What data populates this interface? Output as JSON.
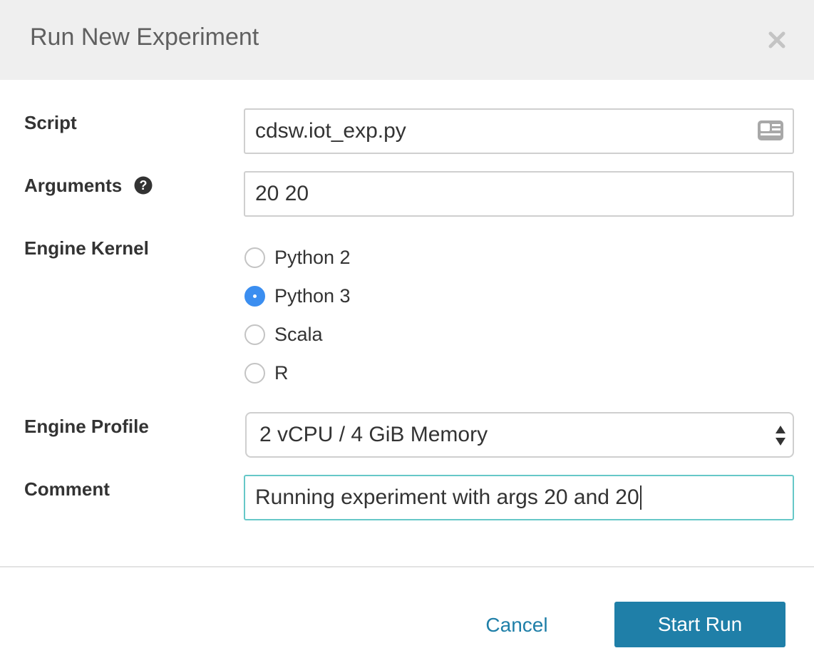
{
  "dialog": {
    "title": "Run New Experiment",
    "close_icon": "close-icon"
  },
  "form": {
    "script": {
      "label": "Script",
      "value": "cdsw.iot_exp.py",
      "icon": "file-browse-icon"
    },
    "arguments": {
      "label": "Arguments",
      "value": "20 20",
      "help_icon": "question-circle-icon"
    },
    "engine_kernel": {
      "label": "Engine Kernel",
      "options": [
        {
          "label": "Python 2",
          "checked": false
        },
        {
          "label": "Python 3",
          "checked": true
        },
        {
          "label": "Scala",
          "checked": false
        },
        {
          "label": "R",
          "checked": false
        }
      ],
      "accent": "#3b8ef0"
    },
    "engine_profile": {
      "label": "Engine Profile",
      "selected": "2 vCPU / 4 GiB Memory"
    },
    "comment": {
      "label": "Comment",
      "value": "Running experiment with args 20 and 20",
      "focus_color": "#66c8c8"
    }
  },
  "footer": {
    "cancel_label": "Cancel",
    "start_label": "Start Run",
    "primary_color": "#1f7fa8"
  }
}
